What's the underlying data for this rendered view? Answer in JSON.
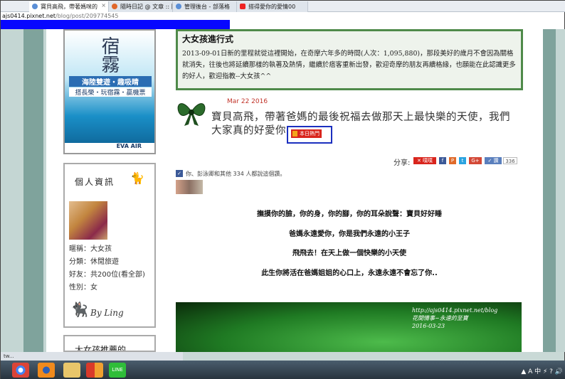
{
  "browser": {
    "tabs": [
      {
        "label": "寶貝高飛，帶著媽咪的",
        "active": true
      },
      {
        "label": "隨時日記 @ 文章 :: 隨意窩",
        "active": false
      },
      {
        "label": "管理後台 - 部落格",
        "active": false
      },
      {
        "label": "搭得愛你的愛情00",
        "active": false
      }
    ],
    "address_host": "ajs0414.pixnet.net",
    "address_path": "/blog/post/209774545"
  },
  "announcement": {
    "title": "大女孩進行式",
    "text": "2013-09-01日新的里程就從這裡開始，在奇摩六年多的時間(人次：1,095,880)，那段美好的歲月不會因為關格就消失，往後也將延續那樣的執著及熱情，繼續於痞客重新出發，歡迎奇摩的朋友再續格緣，也願能在此認識更多的好人，歡迎指教--大女孩^^"
  },
  "ad": {
    "big": "宿霧",
    "line1": "海陸雙遊・趣吸睛",
    "line2": "搭長榮・玩宿霧・贏機票",
    "footer": "EVA AIR"
  },
  "profile": {
    "title": "個人資訊",
    "nickname_label": "暱稱：",
    "nickname": "大女孩",
    "category_label": "分類：",
    "category": "休閒旅遊",
    "friends_label": "好友：",
    "friends": "共200位",
    "friends_link": "看全部",
    "gender_label": "性別：",
    "gender": "女",
    "signature": "By Ling"
  },
  "next_box": {
    "title": "大女孩推薦的"
  },
  "post": {
    "date": "Mar 22 2016",
    "title": "寶貝高飛，帶著爸媽的最後祝福去做那天上最快樂的天使，我們大家真的好愛你",
    "hot_badge": "本日熱門",
    "share_label": "分享:",
    "share_count": "336",
    "like_text": "你、彭泳卿和其他 334 人都說這個讚。",
    "paragraphs": [
      "撫摸你的臉，你的身，你的腳，你的耳朵說聲：寶貝好好睡",
      "爸媽永遠愛你，你是我們永遠的小王子",
      "飛飛去！在天上做一個快樂的小天使",
      "此生你將活在爸媽姐姐的心口上，永遠永遠不會忘了你.."
    ],
    "photo_caption": [
      "http://ajs0414.pixnet.net/blog",
      "花間情事~永遠的至寶",
      "2016-03-23"
    ]
  },
  "status_text": "tw..."
}
